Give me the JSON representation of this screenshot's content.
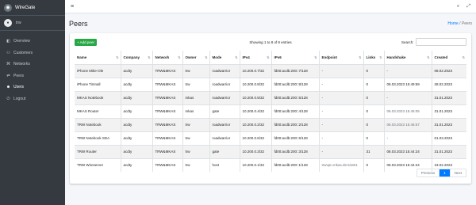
{
  "brand": {
    "name": "WireGate"
  },
  "user": {
    "name": "trw"
  },
  "sidebar": {
    "items": [
      {
        "label": "Overview",
        "icon": "dashboard-icon"
      },
      {
        "label": "Customers",
        "icon": "users-icon"
      },
      {
        "label": "Networks",
        "icon": "network-icon"
      },
      {
        "label": "Peers",
        "icon": "peers-icon"
      },
      {
        "label": "Users",
        "icon": "user-icon"
      },
      {
        "label": "Logout",
        "icon": "logout-icon"
      }
    ]
  },
  "header": {
    "title": "Peers",
    "breadcrumb_home": "Home",
    "breadcrumb_sep": "/",
    "breadcrumb_current": "Peers"
  },
  "toolbar": {
    "add_label": "+ Add peer",
    "info": "Showing 1 to 8 of 8 entries",
    "search_label": "Search:"
  },
  "table": {
    "columns": [
      "Name",
      "Company",
      "Network",
      "Owner",
      "Mode",
      "IPv4",
      "IPv6",
      "Endpoint",
      "Links",
      "Handshake",
      "Created"
    ],
    "rows": [
      [
        "iPhone Mike-Ole",
        "acdty",
        "TRW&MKAS",
        "trw",
        "roadwarrior",
        "10.200.0.7/32",
        "fd00:acdb:200::7/128",
        "-",
        "0",
        "-",
        "08.02.2023"
      ],
      [
        "iPhone Timnall",
        "acdty",
        "TRW&MKAS",
        "trw",
        "roadwarrior",
        "10.200.0.8/32",
        "fd00:acdb:200::8/128",
        "-",
        "0",
        "08.03.2023 15:49:59",
        "28.02.2023"
      ],
      [
        "MKAS Notebook",
        "acdty",
        "TRW&MKAS",
        "mkas",
        "roadwarrior",
        "10.200.0.5/32",
        "fd00:acdb:200::5/128",
        "-",
        "0",
        "-",
        "31.01.2023"
      ],
      [
        "MKAS Router",
        "acdty",
        "TRW&MKAS",
        "mkas",
        "gate",
        "10.200.0.4/32",
        "fd00:acdb:200::4/128",
        "-",
        "0",
        "08.03.2023 15:45:05",
        "31.01.2023"
      ],
      [
        "TRW Notebook",
        "acdty",
        "TRW&MKAS",
        "trw",
        "roadwarrior",
        "10.200.0.2/32",
        "fd00:acdb:200::2/128",
        "-",
        "0",
        "08.03.2023 15:46:57",
        "31.01.2023"
      ],
      [
        "TRW Notebook SDA",
        "acdty",
        "TRW&MKAS",
        "trw",
        "roadwarrior",
        "10.200.0.6/32",
        "fd00:acdb:200::6/128",
        "-",
        "0",
        "-",
        "01.03.2023"
      ],
      [
        "TRW Router",
        "acdty",
        "TRW&MKAS",
        "trw",
        "gate",
        "10.200.0.3/32",
        "fd00:acdb:200::3/128",
        "-",
        "31",
        "08.03.2023 15:44:24",
        "31.01.2023"
      ],
      [
        "TRW Wireserver",
        "acdty",
        "TRW&MKAS",
        "trw",
        "host",
        "10.200.0.1/32",
        "fd00:acdb:200::1/128",
        "trwvpn.mkas.de:51821",
        "0",
        "08.03.2023 15:44:24",
        "23.02.2023"
      ]
    ]
  },
  "pager": {
    "prev": "Previous",
    "page": "1",
    "next": "Next"
  }
}
